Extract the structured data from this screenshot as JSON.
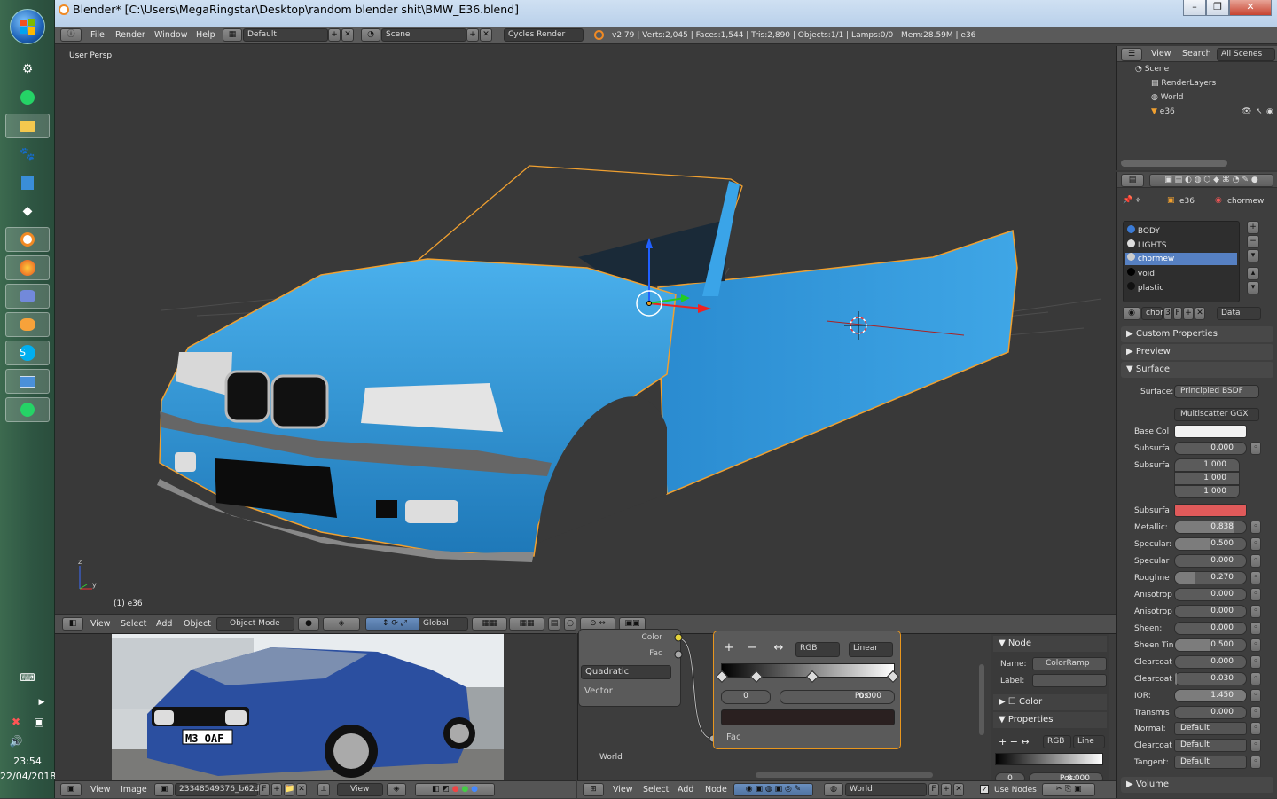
{
  "window": {
    "title": "Blender* [C:\\Users\\MegaRingstar\\Desktop\\random blender shit\\BMW_E36.blend]"
  },
  "taskbar": {
    "time": "23:54",
    "date": "22/04/2018"
  },
  "menu": {
    "file": "File",
    "render": "Render",
    "window": "Window",
    "help": "Help"
  },
  "layout": {
    "screen": "Default",
    "scene": "Scene",
    "engine": "Cycles Render"
  },
  "stats": "v2.79 | Verts:2,045 | Faces:1,544 | Tris:2,890 | Objects:1/1 | Lamps:0/0 | Mem:28.59M | e36",
  "viewport": {
    "label": "User Persp",
    "object_label": "(1) e36",
    "menus": {
      "view": "View",
      "select": "Select",
      "add": "Add",
      "object": "Object"
    },
    "mode": "Object Mode",
    "orientation": "Global",
    "axis_x": "x",
    "axis_y": "y",
    "axis_z": "z"
  },
  "outliner": {
    "view": "View",
    "search": "Search",
    "filter": "All Scenes",
    "items": [
      "Scene",
      "RenderLayers",
      "World",
      "e36"
    ]
  },
  "properties": {
    "object": "e36",
    "material": "chormew",
    "materials": [
      "BODY",
      "LIGHTS",
      "chormew",
      "void",
      "plastic"
    ],
    "mat_field": "chor",
    "mat_users": "3",
    "mat_fake": "F",
    "link": "Data",
    "sections": {
      "custom": "Custom Properties",
      "preview": "Preview",
      "surface": "Surface",
      "volume": "Volume"
    },
    "surface_label": "Surface:",
    "surface_shader": "Principled BSDF",
    "distribution": "Multiscatter GGX",
    "base_color_label": "Base Col",
    "subsurface_rows": [
      {
        "label": "Subsurfa",
        "value": "0.000",
        "fill": 0.0
      }
    ],
    "radius_label": "Subsurfa",
    "radius_values": [
      "1.000",
      "1.000",
      "1.000"
    ],
    "subsurface_color_label": "Subsurfa",
    "rows": [
      {
        "label": "Metallic:",
        "value": "0.838",
        "fill": 0.838
      },
      {
        "label": "Specular:",
        "value": "0.500",
        "fill": 0.5
      },
      {
        "label": "Specular",
        "value": "0.000",
        "fill": 0.0
      },
      {
        "label": "Roughne",
        "value": "0.270",
        "fill": 0.27
      },
      {
        "label": "Anisotrop",
        "value": "0.000",
        "fill": 0.0
      },
      {
        "label": "Anisotrop",
        "value": "0.000",
        "fill": 0.0
      },
      {
        "label": "Sheen:",
        "value": "0.000",
        "fill": 0.0
      },
      {
        "label": "Sheen Tin",
        "value": "0.500",
        "fill": 0.5
      },
      {
        "label": "Clearcoat",
        "value": "0.000",
        "fill": 0.0
      },
      {
        "label": "Clearcoat",
        "value": "0.030",
        "fill": 0.03
      },
      {
        "label": "IOR:",
        "value": "1.450",
        "fill": 1.0
      },
      {
        "label": "Transmis",
        "value": "0.000",
        "fill": 0.0
      }
    ],
    "normal_rows": [
      {
        "label": "Normal:",
        "value": "Default"
      },
      {
        "label": "Clearcoat",
        "value": "Default"
      },
      {
        "label": "Tangent:",
        "value": "Default"
      }
    ],
    "colors": {
      "base": "#f2f2f2",
      "subsurface": "#e05a5a"
    }
  },
  "image_editor": {
    "menus": {
      "view": "View",
      "image": "Image"
    },
    "image_name": "23348549376_b62d...",
    "fake": "F",
    "view_mode": "View",
    "plate": "M3 OAF"
  },
  "node_editor": {
    "menus": {
      "view": "View",
      "select": "Select",
      "add": "Add",
      "node": "Node"
    },
    "world": "World",
    "fake": "F",
    "use_nodes": "Use Nodes",
    "corner_label": "World",
    "gradient": {
      "color_label": "Color",
      "fac_label": "Fac",
      "type": "Quadratic",
      "vector_label": "Vector"
    },
    "ramp": {
      "mode": "RGB",
      "interp": "Linear",
      "index": "0",
      "pos_label": "Pos:",
      "pos_value": "0.000",
      "fac": "Fac"
    },
    "side": {
      "node_title": "Node",
      "name_label": "Name:",
      "name_value": "ColorRamp",
      "label_label": "Label:",
      "color_title": "Color",
      "props_title": "Properties",
      "rgb": "RGB",
      "line": "Line",
      "pos_partial": "Pos:",
      "pos_val": "0.000"
    }
  }
}
